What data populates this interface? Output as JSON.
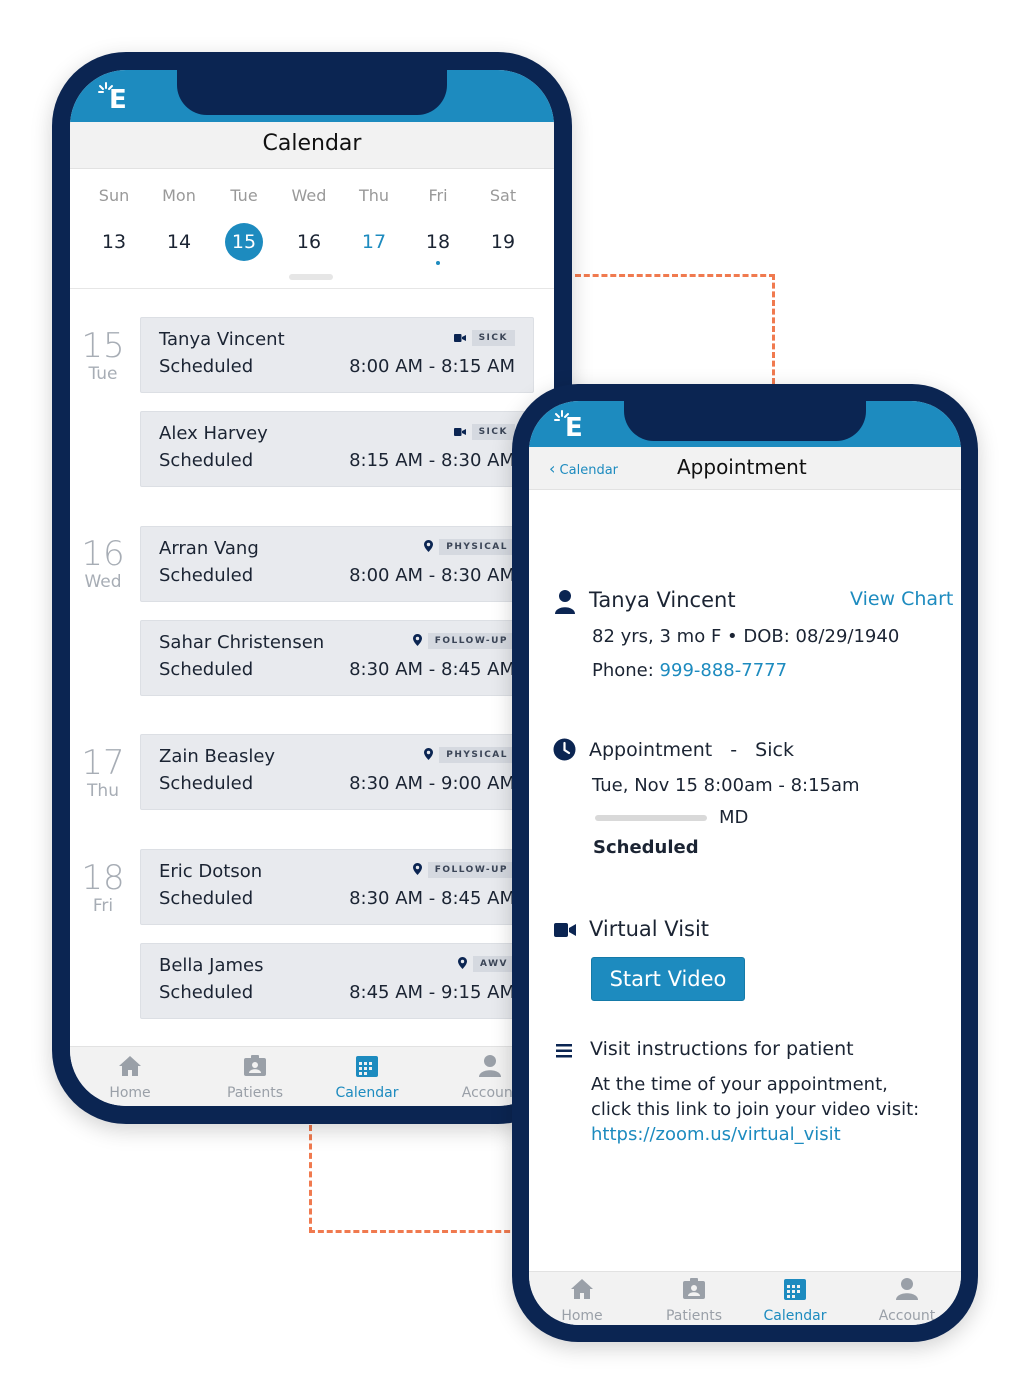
{
  "colors": {
    "accent": "#1d8bbf",
    "frame": "#0b2552",
    "connector": "#f07a4f",
    "card": "#e8eaee"
  },
  "calendar_screen": {
    "logo": "E",
    "title": "Calendar",
    "week": [
      {
        "name": "Sun",
        "num": "13"
      },
      {
        "name": "Mon",
        "num": "14"
      },
      {
        "name": "Tue",
        "num": "15",
        "selected": true
      },
      {
        "name": "Wed",
        "num": "16"
      },
      {
        "name": "Thu",
        "num": "17",
        "today": true
      },
      {
        "name": "Fri",
        "num": "18",
        "has_dot": true
      },
      {
        "name": "Sat",
        "num": "19"
      }
    ],
    "groups": [
      {
        "num": "15",
        "day": "Tue"
      },
      {
        "num": "16",
        "day": "Wed"
      },
      {
        "num": "17",
        "day": "Thu"
      },
      {
        "num": "18",
        "day": "Fri"
      }
    ],
    "appointments": [
      {
        "name": "Tanya Vincent",
        "status": "Scheduled",
        "time": "8:00 AM - 8:15 AM",
        "tag": "SICK",
        "icon": "video-icon"
      },
      {
        "name": "Alex Harvey",
        "status": "Scheduled",
        "time": "8:15 AM - 8:30 AM",
        "tag": "SICK",
        "icon": "video-icon"
      },
      {
        "name": "Arran Vang",
        "status": "Scheduled",
        "time": "8:00 AM - 8:30 AM",
        "tag": "PHYSICAL",
        "icon": "location-icon"
      },
      {
        "name": "Sahar Christensen",
        "status": "Scheduled",
        "time": "8:30 AM - 8:45 AM",
        "tag": "FOLLOW-UP",
        "icon": "location-icon"
      },
      {
        "name": "Zain Beasley",
        "status": "Scheduled",
        "time": "8:30 AM - 9:00 AM",
        "tag": "PHYSICAL",
        "icon": "location-icon"
      },
      {
        "name": "Eric Dotson",
        "status": "Scheduled",
        "time": "8:30 AM - 8:45 AM",
        "tag": "FOLLOW-UP",
        "icon": "location-icon"
      },
      {
        "name": "Bella James",
        "status": "Scheduled",
        "time": "8:45 AM - 9:15 AM",
        "tag": "AWV",
        "icon": "location-icon"
      }
    ],
    "tabs": [
      "Home",
      "Patients",
      "Calendar",
      "Account"
    ],
    "active_tab": "Calendar"
  },
  "appointment_screen": {
    "logo": "E",
    "back_label": "Calendar",
    "title": "Appointment",
    "patient_name": "Tanya Vincent",
    "view_chart": "View Chart",
    "demographics": "82 yrs, 3 mo F • DOB: 08/29/1940",
    "phone_label": "Phone: ",
    "phone": "999-888-7777",
    "appointment_label": "Appointment",
    "appointment_sep": "-",
    "appointment_type": "Sick",
    "appointment_time": "Tue, Nov 15 8:00am - 8:15am",
    "provider_suffix": "MD",
    "appointment_status": "Scheduled",
    "virtual_visit_title": "Virtual Visit",
    "start_video": "Start Video",
    "instructions_title": "Visit instructions for patient",
    "instructions_line1": "At the time of your appointment,",
    "instructions_line2": "click this link to join your video visit:",
    "instructions_link": "https://zoom.us/virtual_visit",
    "tabs": [
      "Home",
      "Patients",
      "Calendar",
      "Account"
    ],
    "active_tab": "Calendar"
  }
}
